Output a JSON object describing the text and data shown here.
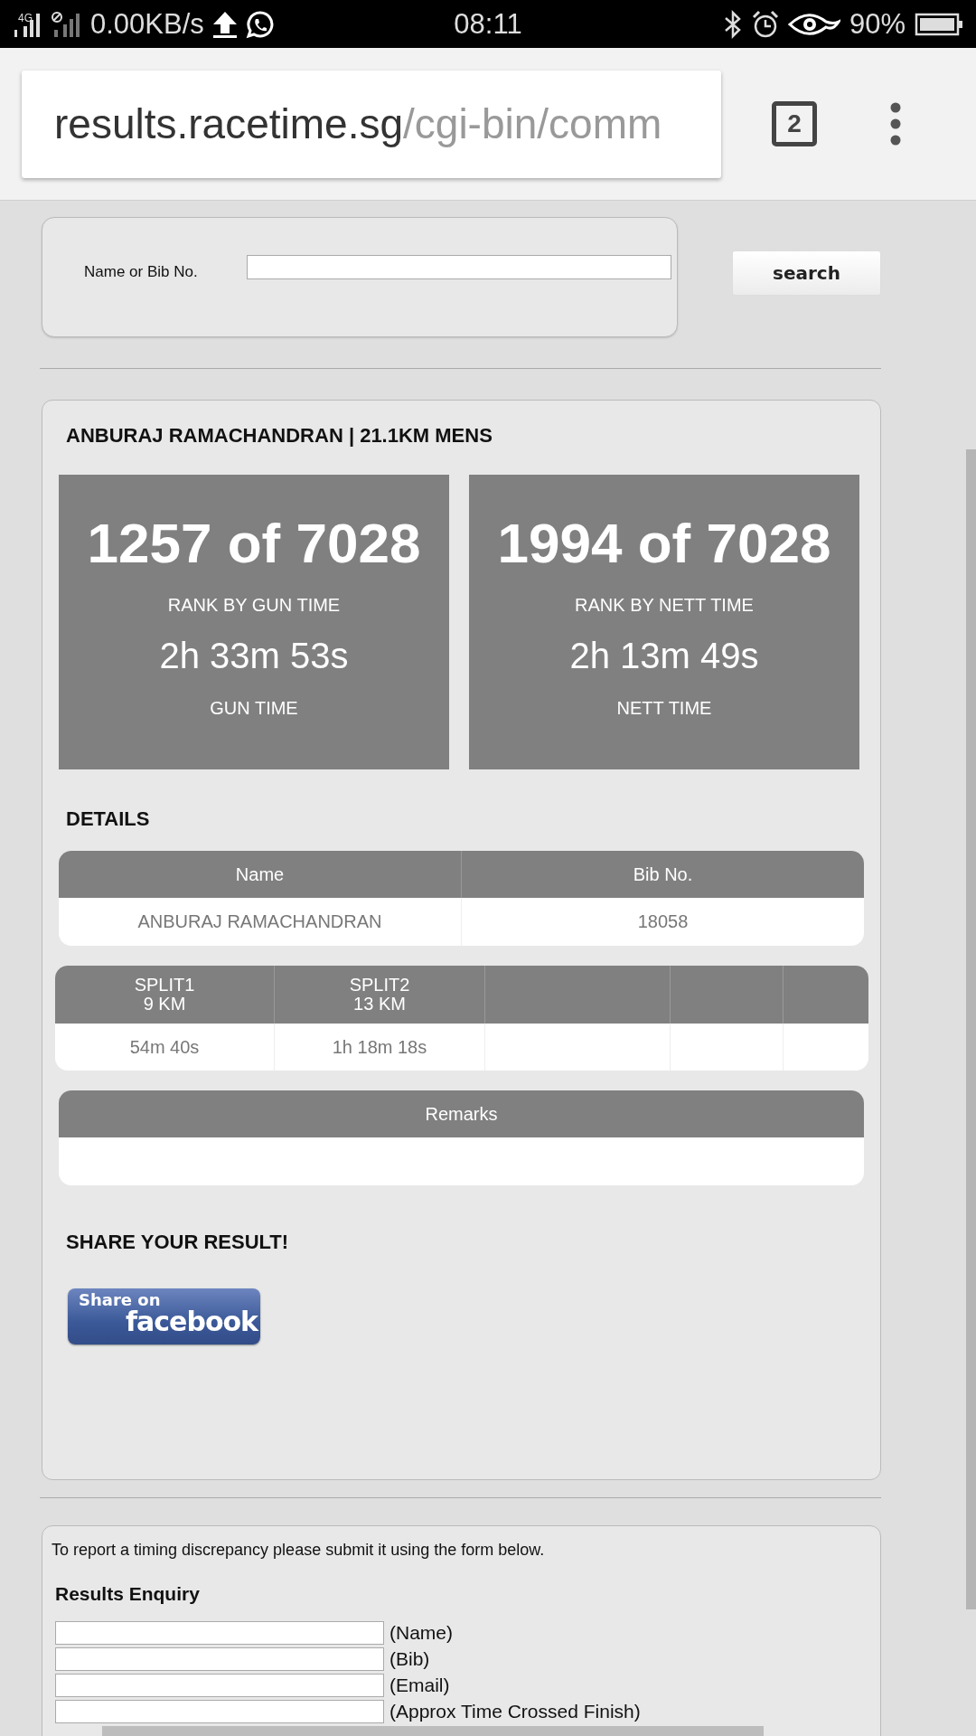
{
  "status_bar": {
    "network": "4G",
    "data_speed": "0.00KB/s",
    "time": "08:11",
    "battery": "90%"
  },
  "browser": {
    "url_host": "results.racetime.sg",
    "url_path": "/cgi-bin/comm",
    "tab_count": "2"
  },
  "search": {
    "label": "Name or Bib No.",
    "button": "search"
  },
  "result": {
    "title": "ANBURAJ RAMACHANDRAN | 21.1KM MENS",
    "ranks": [
      {
        "rank": "1257 of 7028",
        "rank_label": "RANK BY GUN TIME",
        "time": "2h 33m 53s",
        "time_label": "GUN TIME"
      },
      {
        "rank": "1994 of 7028",
        "rank_label": "RANK BY NETT TIME",
        "time": "2h 13m 49s",
        "time_label": "NETT TIME"
      }
    ],
    "details_heading": "DETAILS",
    "details_table": {
      "columns": [
        "Name",
        "Bib No."
      ],
      "row": [
        "ANBURAJ RAMACHANDRAN",
        "18058"
      ]
    },
    "splits_table": {
      "columns": [
        {
          "kind": "split",
          "label": "SPLIT1\n9 KM",
          "value": "54m 40s"
        },
        {
          "kind": "split",
          "label": "SPLIT2\n13 KM",
          "value": "1h 18m 18s"
        },
        {
          "kind": "empty"
        },
        {
          "kind": "empty"
        },
        {
          "kind": "empty"
        }
      ]
    },
    "remarks_table": {
      "header": "Remarks"
    },
    "share_heading": "SHARE YOUR RESULT!",
    "share_button": {
      "line1": "Share on",
      "line2": "facebook"
    }
  },
  "enquiry": {
    "intro": "To report a timing discrepancy please submit it using the form below.",
    "heading": "Results Enquiry",
    "fields": [
      {
        "label": "(Name)"
      },
      {
        "label": "(Bib)"
      },
      {
        "label": "(Email)"
      },
      {
        "label": "(Approx Time Crossed Finish)"
      }
    ]
  }
}
